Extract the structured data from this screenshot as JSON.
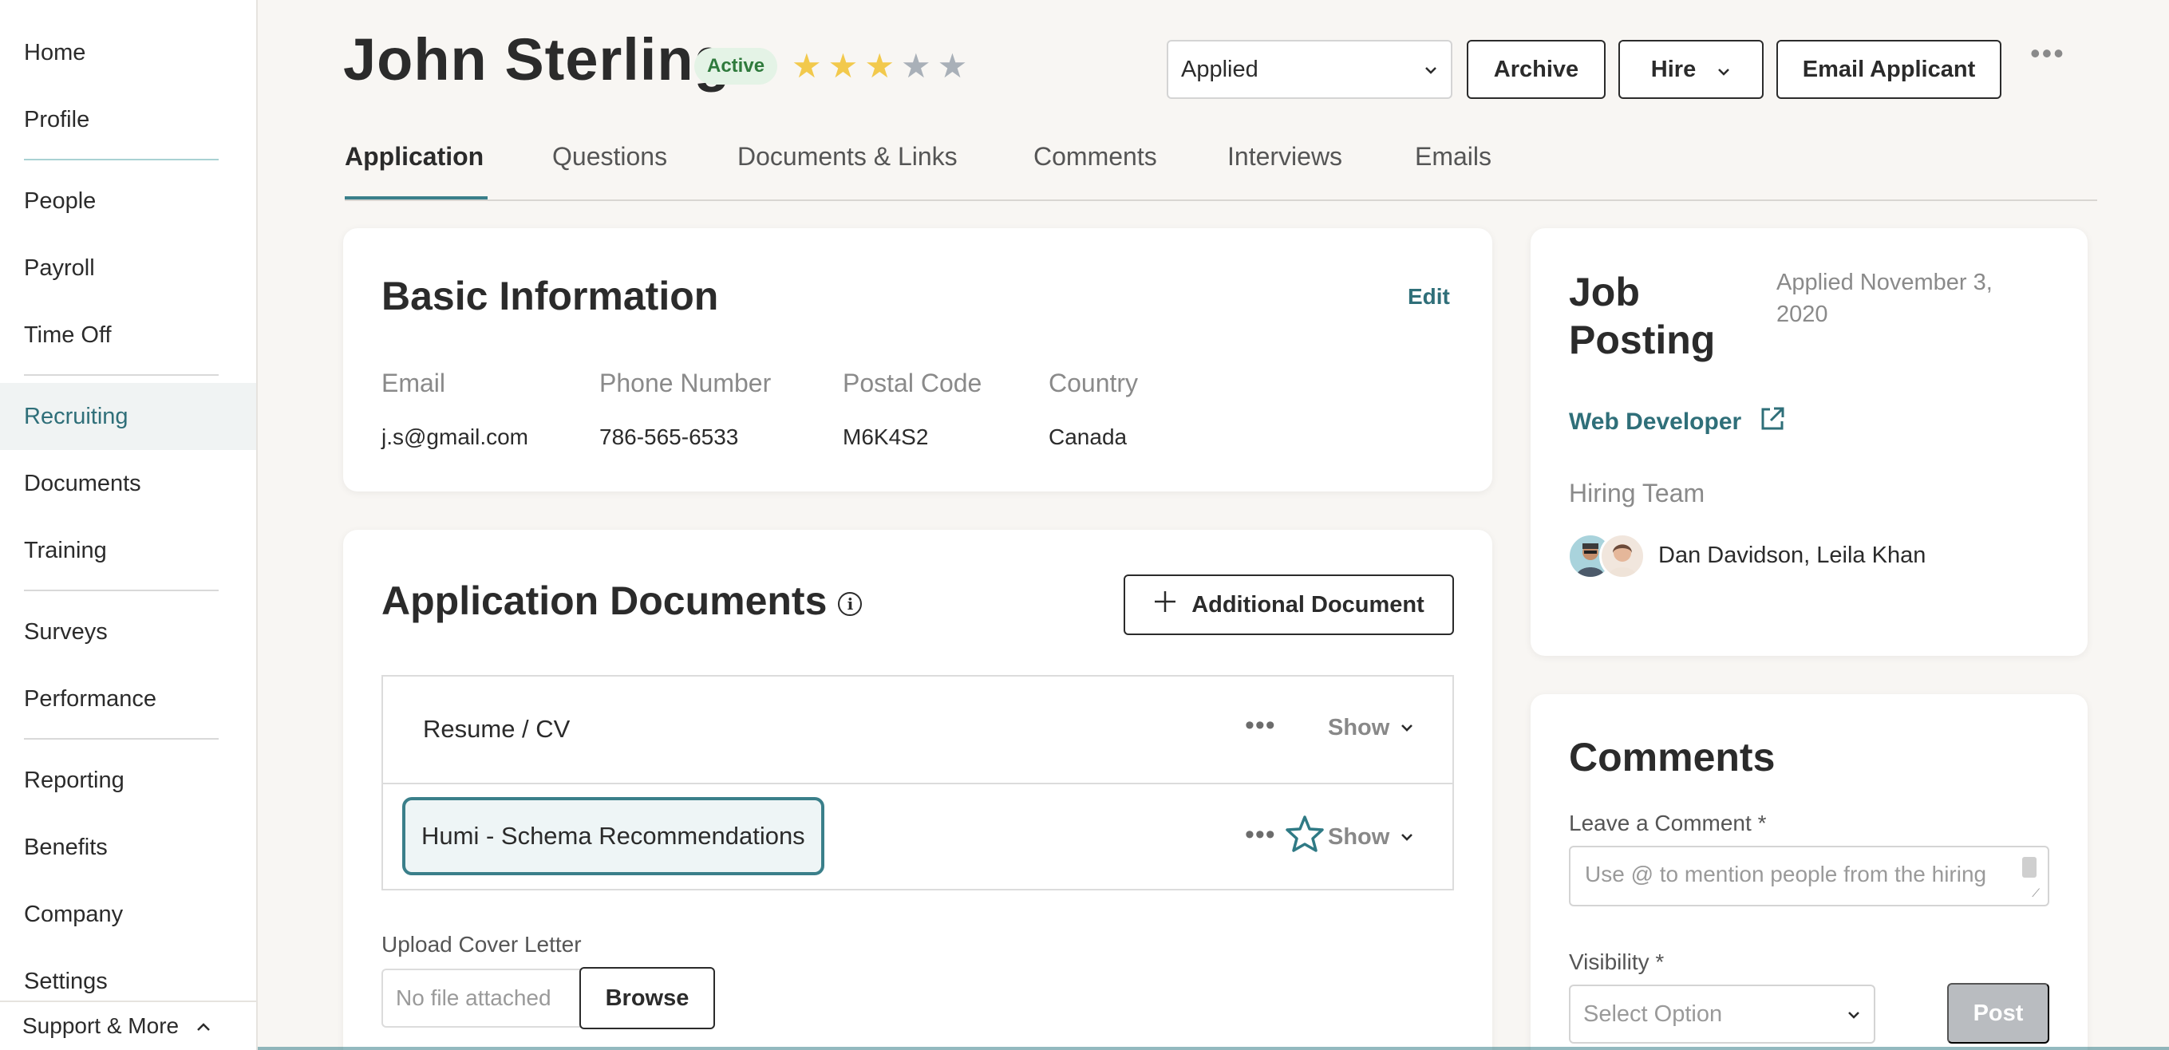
{
  "sidebar": {
    "items": [
      {
        "label": "Home"
      },
      {
        "label": "Profile"
      },
      {
        "label": "People"
      },
      {
        "label": "Payroll"
      },
      {
        "label": "Time Off"
      },
      {
        "label": "Recruiting"
      },
      {
        "label": "Documents"
      },
      {
        "label": "Training"
      },
      {
        "label": "Surveys"
      },
      {
        "label": "Performance"
      },
      {
        "label": "Reporting"
      },
      {
        "label": "Benefits"
      },
      {
        "label": "Company"
      },
      {
        "label": "Settings"
      }
    ],
    "active_item": "Recruiting",
    "support_label": "Support & More"
  },
  "header": {
    "applicant_name": "John Sterling",
    "status_badge": "Active",
    "rating": 3,
    "rating_max": 5,
    "stage_select": "Applied",
    "archive_label": "Archive",
    "hire_label": "Hire",
    "email_label": "Email Applicant"
  },
  "tabs": [
    {
      "label": "Application"
    },
    {
      "label": "Questions"
    },
    {
      "label": "Documents & Links"
    },
    {
      "label": "Comments"
    },
    {
      "label": "Interviews"
    },
    {
      "label": "Emails"
    }
  ],
  "active_tab": "Application",
  "basic_info": {
    "title": "Basic Information",
    "edit_label": "Edit",
    "fields": [
      {
        "label": "Email",
        "value": "j.s@gmail.com"
      },
      {
        "label": "Phone Number",
        "value": "786-565-6533"
      },
      {
        "label": "Postal Code",
        "value": "M6K4S2"
      },
      {
        "label": "Country",
        "value": "Canada"
      }
    ]
  },
  "app_documents": {
    "title": "Application Documents",
    "add_label": "Additional Document",
    "rows": [
      {
        "name": "Resume / CV",
        "show_label": "Show"
      },
      {
        "name": "Humi - Schema Recommendations",
        "show_label": "Show"
      }
    ],
    "upload_label": "Upload Cover Letter",
    "upload_placeholder": "No file attached",
    "browse_label": "Browse"
  },
  "job_posting": {
    "title": "Job Posting",
    "applied_date": "Applied November 3, 2020",
    "job_title": "Web Developer",
    "hiring_team_label": "Hiring Team",
    "hiring_team_members": "Dan Davidson, Leila Khan"
  },
  "comments": {
    "title": "Comments",
    "leave_comment_label": "Leave a Comment *",
    "comment_placeholder": "Use @ to mention people from the hiring",
    "visibility_label": "Visibility *",
    "visibility_placeholder": "Select Option",
    "post_label": "Post"
  },
  "colors": {
    "accent": "#2f6f79",
    "badge_bg": "#e4f3e6",
    "badge_text": "#2f7a3c",
    "star_on": "#f2c94c",
    "star_off": "#a9b0b8",
    "page_bg": "#f8f6f3"
  }
}
